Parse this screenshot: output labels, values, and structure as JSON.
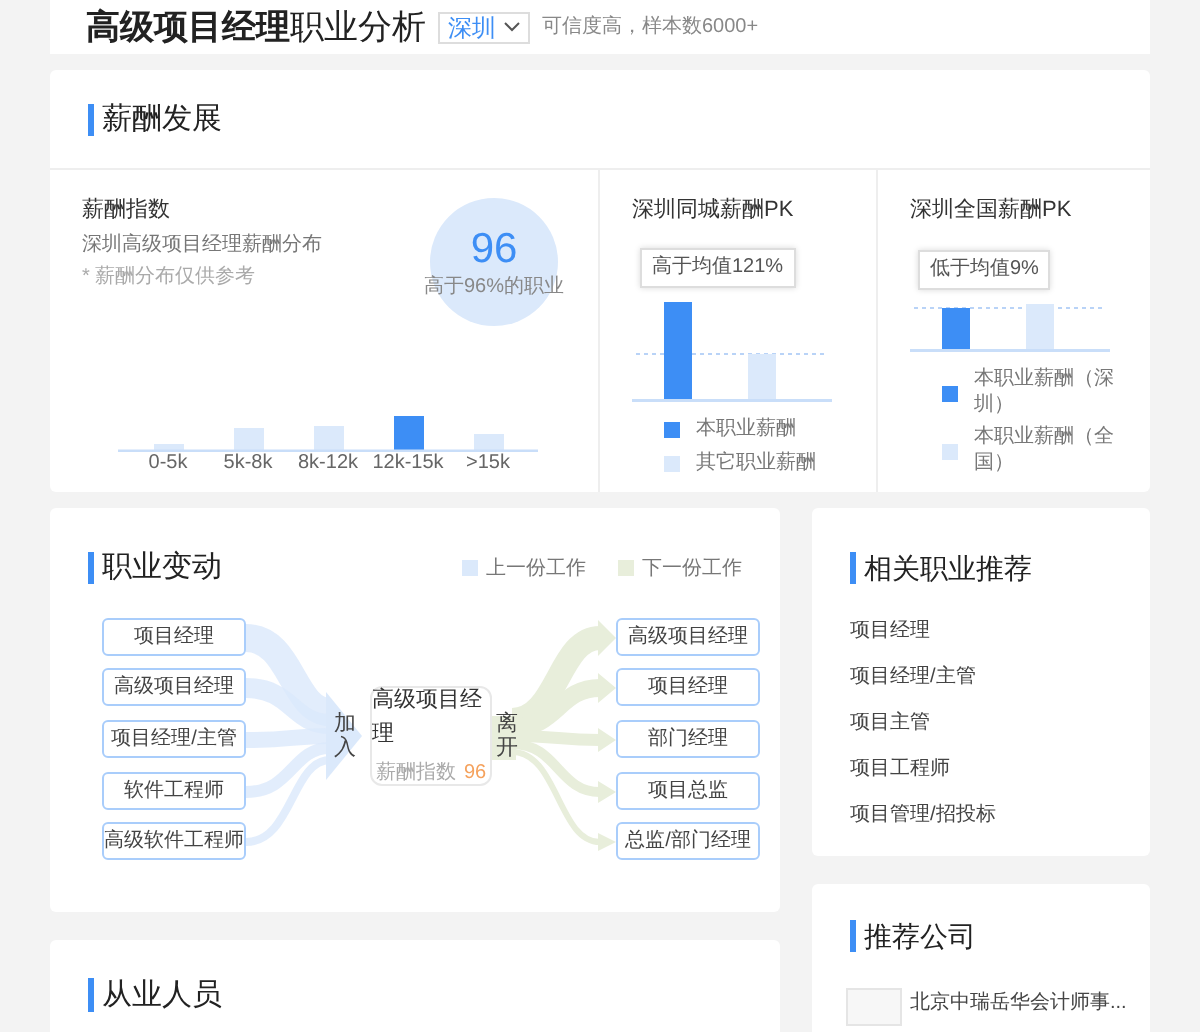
{
  "header": {
    "title": "**高级项目经理**职业分析",
    "city_select": {
      "value": "深圳"
    },
    "note": "可信度高，样本数6000+"
  },
  "salary": {
    "title": "薪酬发展",
    "index": {
      "title": "薪酬指数",
      "subtitle": "深圳高级项目经理薪酬分布",
      "footnote": "* 薪酬分布仅供参考",
      "score": "96",
      "score_caption": "高于96%的职业",
      "bins": [
        {
          "label": "0-5k",
          "selected": false
        },
        {
          "label": "5k-8k",
          "selected": false
        },
        {
          "label": "8k-12k",
          "selected": false
        },
        {
          "label": "12k-15k",
          "selected": true
        },
        {
          "label": ">15k",
          "selected": false
        }
      ]
    },
    "pk": [
      {
        "title": "深圳同城薪酬PK",
        "tooltip": "高于均值121%",
        "legend": [
          {
            "label": "本职业薪酬",
            "color": "#3d8ef5"
          },
          {
            "label": "其它职业薪酬",
            "color": "#dbe9fb"
          }
        ]
      },
      {
        "title": "深圳全国薪酬PK",
        "tooltip": "低于均值9%",
        "legend": [
          {
            "label": "本职业薪酬（深圳）",
            "color": "#3d8ef5"
          },
          {
            "label": "本职业薪酬（全国）",
            "color": "#dbe9fb"
          }
        ]
      }
    ]
  },
  "career": {
    "title": "职业变动",
    "legend": [
      {
        "label": "上一份工作",
        "color": "#dbe9fb"
      },
      {
        "label": "下一份工作",
        "color": "#e8eedb"
      }
    ],
    "previous": [
      "项目经理",
      "高级项目经理",
      "项目经理/主管",
      "软件工程师",
      "高级软件工程师"
    ],
    "join_label": "加入",
    "center": {
      "title": "高级项目经理",
      "index_label": "薪酬指数",
      "index_value": "96"
    },
    "leave_label": "离开",
    "next": [
      "高级项目经理",
      "项目经理",
      "部门经理",
      "项目总监",
      "总监/部门经理"
    ]
  },
  "staff": {
    "title": "从业人员"
  },
  "related": {
    "title": "相关职业推荐",
    "items": [
      "项目经理",
      "项目经理/主管",
      "项目主管",
      "项目工程师",
      "项目管理/招投标"
    ]
  },
  "companies": {
    "title": "推荐公司",
    "items": [
      {
        "name": "北京中瑞岳华会计师事..."
      }
    ]
  }
}
